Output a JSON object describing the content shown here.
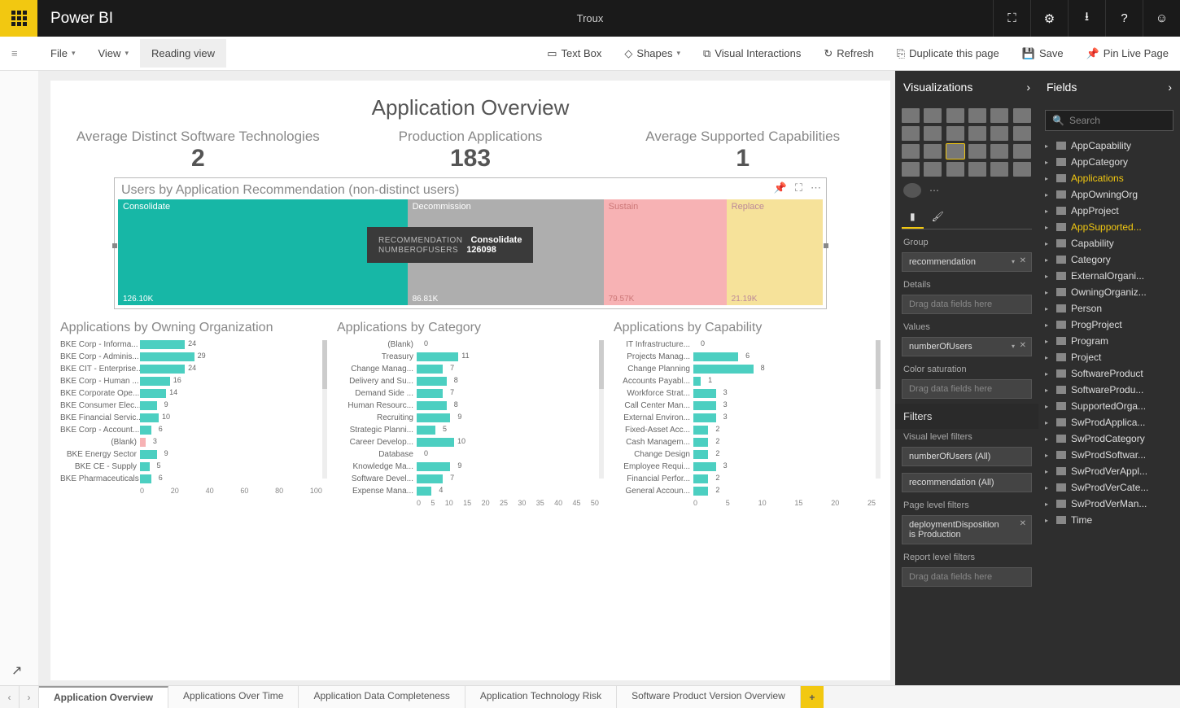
{
  "app_title": "Power BI",
  "doc_title": "Troux",
  "ribbon": {
    "file": "File",
    "view": "View",
    "reading": "Reading view",
    "textbox": "Text Box",
    "shapes": "Shapes",
    "interactions": "Visual Interactions",
    "refresh": "Refresh",
    "duplicate": "Duplicate this page",
    "save": "Save",
    "pin": "Pin Live Page"
  },
  "report_title": "Application Overview",
  "kpis": {
    "avg_tech": {
      "label": "Average Distinct Software Technologies",
      "value": "2"
    },
    "prod_apps": {
      "label": "Production Applications",
      "value": "183"
    },
    "avg_cap": {
      "label": "Average Supported Capabilities",
      "value": "1"
    }
  },
  "treemap": {
    "title": "Users by Application Recommendation (non-distinct users)",
    "cells": [
      {
        "label": "Consolidate",
        "value": "126.10K"
      },
      {
        "label": "Decommission",
        "value": "86.81K"
      },
      {
        "label": "Sustain",
        "value": "79.57K"
      },
      {
        "label": "Replace",
        "value": "21.19K"
      }
    ],
    "tooltip": {
      "k1": "RECOMMENDATION",
      "v1": "Consolidate",
      "k2": "NUMBEROFUSERS",
      "v2": "126098"
    }
  },
  "chart_data": [
    {
      "type": "bar",
      "title": "Applications by Owning Organization",
      "categories": [
        "BKE Corp - Informa...",
        "BKE Corp - Adminis...",
        "BKE CIT - Enterprise...",
        "BKE Corp - Human ...",
        "BKE Corporate Ope...",
        "BKE Consumer Elec...",
        "BKE Financial Servic...",
        "BKE Corp - Account...",
        "(Blank)",
        "BKE Energy Sector",
        "BKE CE - Supply",
        "BKE Pharmaceuticals"
      ],
      "values": [
        24,
        29,
        24,
        16,
        14,
        9,
        10,
        6,
        3,
        9,
        5,
        6
      ],
      "highlight_index": 8,
      "xaxis": [
        "0",
        "20",
        "40",
        "60",
        "80",
        "100"
      ],
      "xlim": 100
    },
    {
      "type": "bar",
      "title": "Applications by Category",
      "categories": [
        "(Blank)",
        "Treasury",
        "Change Manag...",
        "Delivery and Su...",
        "Demand Side ...",
        "Human Resourc...",
        "Recruiting",
        "Strategic Planni...",
        "Career Develop...",
        "Database",
        "Knowledge Ma...",
        "Software Devel...",
        "Expense Mana..."
      ],
      "values": [
        0,
        11,
        7,
        8,
        7,
        8,
        9,
        5,
        10,
        0,
        9,
        7,
        4
      ],
      "highlight_index": 0,
      "xaxis": [
        "0",
        "5",
        "10",
        "15",
        "20",
        "25",
        "30",
        "35",
        "40",
        "45",
        "50"
      ],
      "xlim": 50
    },
    {
      "type": "bar",
      "title": "Applications by Capability",
      "categories": [
        "IT Infrastructure...",
        "Projects Manag...",
        "Change Planning",
        "Accounts Payabl...",
        "Workforce Strat...",
        "Call Center Man...",
        "External Environ...",
        "Fixed-Asset Acc...",
        "Cash Managem...",
        "Change Design",
        "Employee Requi...",
        "Financial Perfor...",
        "General Accoun..."
      ],
      "values": [
        0,
        6,
        8,
        1,
        3,
        3,
        3,
        2,
        2,
        2,
        3,
        2,
        2
      ],
      "highlight_index": 0,
      "xaxis": [
        "0",
        "5",
        "10",
        "15",
        "20",
        "25"
      ],
      "xlim": 25
    }
  ],
  "viz_pane": {
    "title": "Visualizations",
    "group_lbl": "Group",
    "group_val": "recommendation",
    "details_lbl": "Details",
    "drag_hint": "Drag data fields here",
    "values_lbl": "Values",
    "values_val": "numberOfUsers",
    "satur_lbl": "Color saturation",
    "filters_title": "Filters",
    "vlf_lbl": "Visual level filters",
    "vlf1": "numberOfUsers (All)",
    "vlf2": "recommendation (All)",
    "plf_lbl": "Page level filters",
    "plf1a": "deploymentDisposition",
    "plf1b": "is Production",
    "rlf_lbl": "Report level filters"
  },
  "fields_pane": {
    "title": "Fields",
    "search": "Search",
    "items": [
      "AppCapability",
      "AppCategory",
      "Applications",
      "AppOwningOrg",
      "AppProject",
      "AppSupported...",
      "Capability",
      "Category",
      "ExternalOrgani...",
      "OwningOrganiz...",
      "Person",
      "ProgProject",
      "Program",
      "Project",
      "SoftwareProduct",
      "SoftwareProdu...",
      "SupportedOrga...",
      "SwProdApplica...",
      "SwProdCategory",
      "SwProdSoftwar...",
      "SwProdVerAppl...",
      "SwProdVerCate...",
      "SwProdVerMan...",
      "Time"
    ],
    "selected": [
      2,
      5
    ]
  },
  "page_tabs": [
    "Application Overview",
    "Applications Over Time",
    "Application Data Completeness",
    "Application Technology Risk",
    "Software Product Version Overview"
  ]
}
